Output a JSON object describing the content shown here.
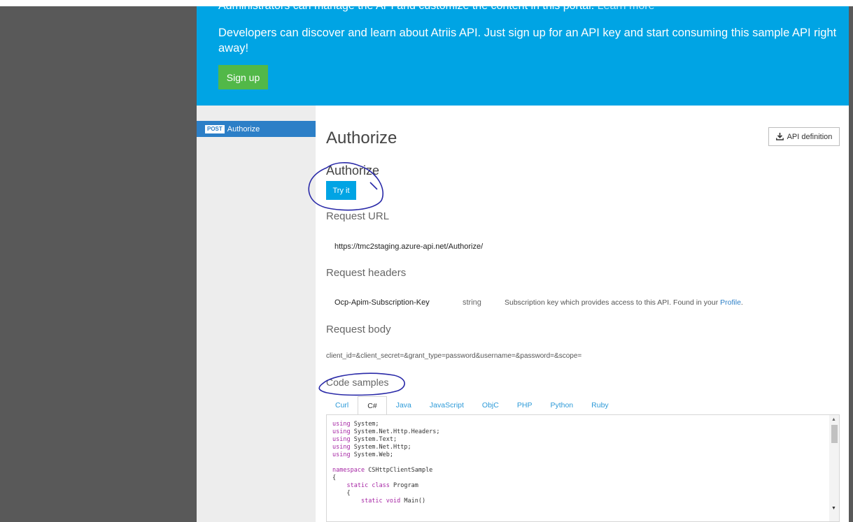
{
  "banner": {
    "admin_text": "Administrators can manage the API and customize the content in this portal.",
    "admin_link": "Learn more",
    "dev_text": "Developers can discover and learn about Atriis API. Just sign up for an API key and start consuming this sample API right away!",
    "signup_label": "Sign up",
    "color": "#00a4e4"
  },
  "sidebar": {
    "items": [
      {
        "method": "POST",
        "label": "Authorize"
      }
    ]
  },
  "main": {
    "title": "Authorize",
    "api_definition_label": "API definition",
    "operation_title": "Authorize",
    "try_label": "Try it",
    "request_url_heading": "Request URL",
    "request_url": "https://tmc2staging.azure-api.net/Authorize/",
    "request_headers_heading": "Request headers",
    "header": {
      "name": "Ocp-Apim-Subscription-Key",
      "type": "string",
      "description": "Subscription key which provides access to this API. Found in your",
      "link": "Profile",
      "period": "."
    },
    "request_body_heading": "Request body",
    "request_body": "client_id=&client_secret=&grant_type=password&username=&password=&scope=",
    "code_samples_heading": "Code samples",
    "tabs": [
      {
        "label": "Curl"
      },
      {
        "label": "C#"
      },
      {
        "label": "Java"
      },
      {
        "label": "JavaScript"
      },
      {
        "label": "ObjC"
      },
      {
        "label": "PHP"
      },
      {
        "label": "Python"
      },
      {
        "label": "Ruby"
      }
    ],
    "active_tab": "C#",
    "code": {
      "using": "using",
      "ns_keyword": "namespace",
      "static_keyword": "static",
      "class_keyword": "class",
      "void_keyword": "void",
      "lines": [
        "System;",
        "System.Net.Http.Headers;",
        "System.Text;",
        "System.Net.Http;",
        "System.Web;"
      ],
      "namespace": "CSHttpClientSample",
      "open_brace": "{",
      "class_name": "Program",
      "main_method": "Main()"
    }
  },
  "colors": {
    "accent": "#00a4e4",
    "signup": "#52b848",
    "selected": "#2c7fc7",
    "annotation": "#2a2aa8"
  },
  "icons": {
    "download": "download-icon"
  }
}
